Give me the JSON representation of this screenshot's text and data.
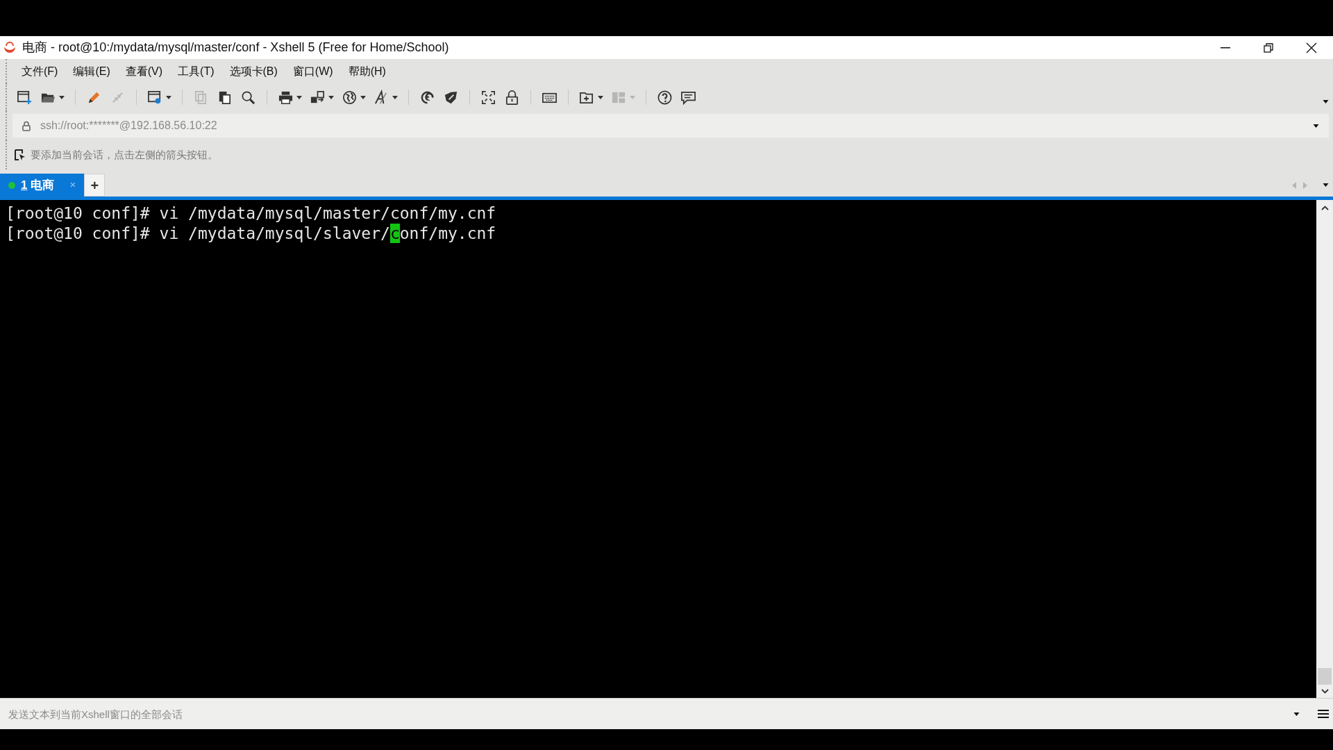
{
  "window": {
    "title": "电商 - root@10:/mydata/mysql/master/conf - Xshell 5 (Free for Home/School)"
  },
  "menu": [
    {
      "label": "文件(F)"
    },
    {
      "label": "编辑(E)"
    },
    {
      "label": "查看(V)"
    },
    {
      "label": "工具(T)"
    },
    {
      "label": "选项卡(B)"
    },
    {
      "label": "窗口(W)"
    },
    {
      "label": "帮助(H)"
    }
  ],
  "toolbar": [
    {
      "kind": "button",
      "disabled": false,
      "dropdown": false
    },
    {
      "kind": "button",
      "disabled": false,
      "dropdown": true
    },
    {
      "kind": "separator"
    },
    {
      "kind": "button",
      "disabled": false,
      "dropdown": false
    },
    {
      "kind": "button",
      "disabled": true,
      "dropdown": false
    },
    {
      "kind": "separator"
    },
    {
      "kind": "button",
      "disabled": false,
      "dropdown": true
    },
    {
      "kind": "separator"
    },
    {
      "kind": "button",
      "disabled": true,
      "dropdown": false
    },
    {
      "kind": "button",
      "disabled": false,
      "dropdown": false
    },
    {
      "kind": "button",
      "disabled": false,
      "dropdown": false
    },
    {
      "kind": "separator"
    },
    {
      "kind": "button",
      "disabled": false,
      "dropdown": true
    },
    {
      "kind": "button",
      "disabled": false,
      "dropdown": true
    },
    {
      "kind": "button",
      "disabled": false,
      "dropdown": true
    },
    {
      "kind": "button",
      "disabled": false,
      "dropdown": true
    },
    {
      "kind": "separator"
    },
    {
      "kind": "button",
      "disabled": false,
      "dropdown": false
    },
    {
      "kind": "button",
      "disabled": false,
      "dropdown": false
    },
    {
      "kind": "separator"
    },
    {
      "kind": "button",
      "disabled": false,
      "dropdown": false
    },
    {
      "kind": "button",
      "disabled": false,
      "dropdown": false
    },
    {
      "kind": "separator"
    },
    {
      "kind": "button",
      "disabled": false,
      "dropdown": false
    },
    {
      "kind": "separator"
    },
    {
      "kind": "button",
      "disabled": false,
      "dropdown": true
    },
    {
      "kind": "button",
      "disabled": true,
      "dropdown": true
    },
    {
      "kind": "separator"
    },
    {
      "kind": "button",
      "disabled": false,
      "dropdown": false
    },
    {
      "kind": "button",
      "disabled": false,
      "dropdown": false
    }
  ],
  "address_bar": {
    "value": "ssh://root:*******@192.168.56.10:22"
  },
  "session_hint": {
    "text": "要添加当前会话，点击左侧的箭头按钮。"
  },
  "tabs": [
    {
      "number": "1",
      "label": "电商",
      "selected": true,
      "connected": true,
      "close": "×"
    }
  ],
  "new_tab": "+",
  "terminal": {
    "lines": [
      {
        "text": "[root@10 conf]# vi /mydata/mysql/master/conf/my.cnf"
      },
      {
        "text": "[root@10 conf]# vi /mydata/mysql/slaver/",
        "cursor": "c",
        "after": "onf/my.cnf"
      }
    ]
  },
  "compose_bar": {
    "placeholder": "发送文本到当前Xshell窗口的全部会话"
  }
}
